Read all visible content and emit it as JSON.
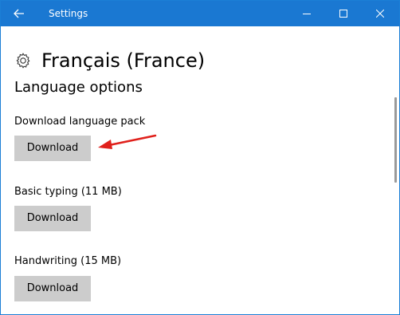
{
  "titlebar": {
    "title": "Settings",
    "icons": {
      "back": "back-arrow-icon",
      "minimize": "minimize-icon",
      "maximize": "maximize-icon",
      "close": "close-icon"
    },
    "color": "#1a78d2"
  },
  "header": {
    "icon": "gear-icon",
    "title": "Français (France)"
  },
  "section": {
    "title": "Language options"
  },
  "options": [
    {
      "label": "Download language pack",
      "button": "Download"
    },
    {
      "label": "Basic typing (11 MB)",
      "button": "Download"
    },
    {
      "label": "Handwriting (15 MB)",
      "button": "Download"
    }
  ],
  "annotation": {
    "icon": "red-arrow-icon",
    "color": "#e0201b"
  }
}
